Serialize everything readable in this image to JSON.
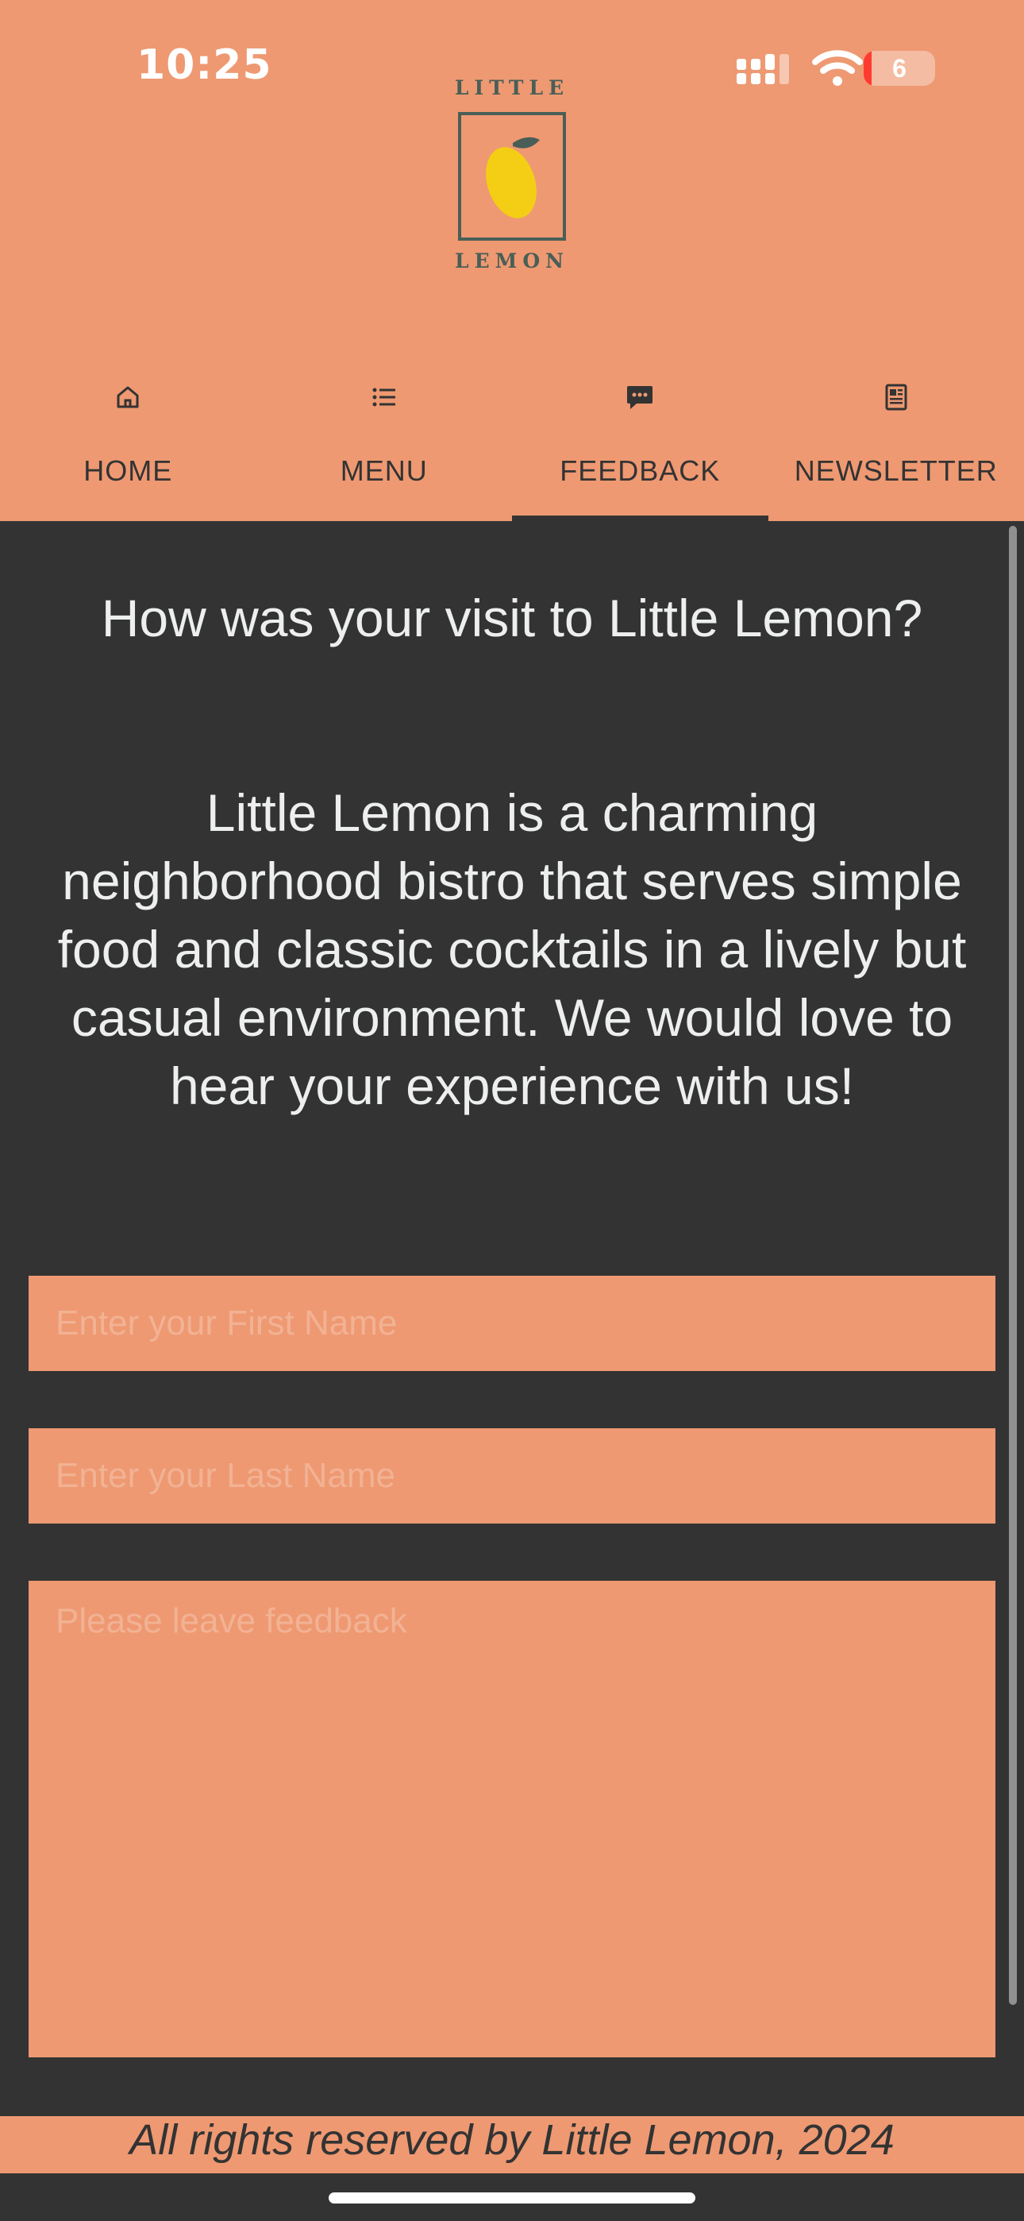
{
  "status_bar": {
    "time": "10:25",
    "battery_level": "6",
    "icons": [
      "cellular-signal-icon",
      "wifi-icon",
      "battery-icon"
    ]
  },
  "logo": {
    "top_word": "LITTLE",
    "bottom_word": "LEMON"
  },
  "tabs": [
    {
      "label": "HOME",
      "icon": "home-icon",
      "active": false
    },
    {
      "label": "MENU",
      "icon": "list-icon",
      "active": false
    },
    {
      "label": "FEEDBACK",
      "icon": "chat-icon",
      "active": true
    },
    {
      "label": "NEWSLETTER",
      "icon": "newspaper-icon",
      "active": false
    }
  ],
  "content": {
    "question": "How was your visit to Little Lemon?",
    "intro": "Little Lemon is a charming neighborhood bistro that serves simple food and classic cocktails in a lively but casual environment. We would love to hear your experience with us!"
  },
  "form": {
    "first_name": {
      "value": "",
      "placeholder": "Enter your First Name"
    },
    "last_name": {
      "value": "",
      "placeholder": "Enter your Last Name"
    },
    "feedback": {
      "value": "",
      "placeholder": "Please leave feedback"
    }
  },
  "footer": {
    "text": "All rights reserved by Little Lemon, 2024"
  },
  "colors": {
    "primary": "#EE9972",
    "background": "#333333",
    "text_light": "#EDEFEE",
    "logo_green": "#495E57",
    "lemon_yellow": "#F4CE14"
  }
}
